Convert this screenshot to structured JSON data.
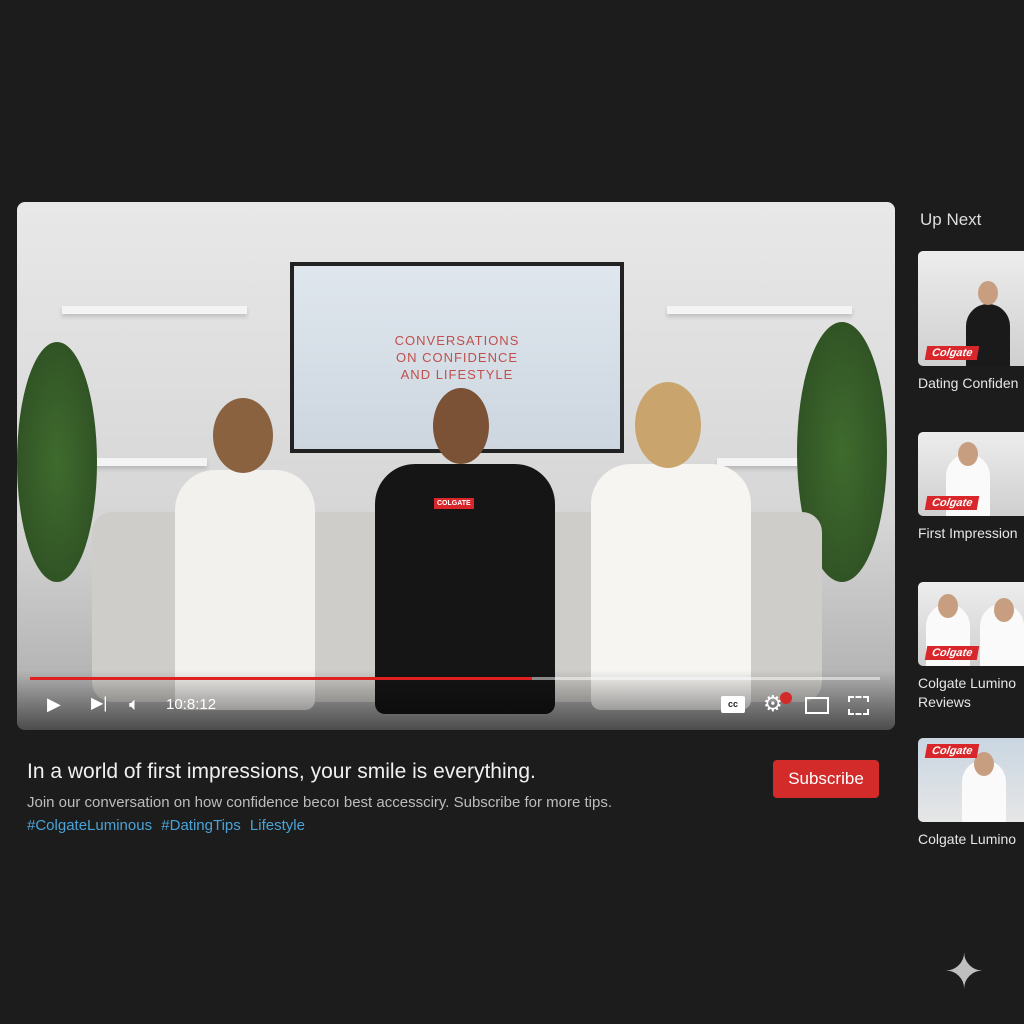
{
  "player": {
    "tv_text": "CONVERSATIONS\nON CONFIDENCE\nAND LIFESTYLE",
    "mic_brand": "COLGATE",
    "progress_percent": 59,
    "time": "10:8:12",
    "icons": [
      "play-icon",
      "next-icon",
      "volume-icon",
      "captions-icon",
      "settings-icon",
      "theater-icon",
      "fullscreen-icon"
    ],
    "settings_badge_color": "#d32a2a"
  },
  "video": {
    "title": "In a world of first impressions, your smile is everything.",
    "description": "Join our conversation on how confidence becoı best accessciry. Subscribe for more tips.",
    "tags": [
      "#ColgateLuminous",
      "#DatingTips",
      "Lifestyle"
    ],
    "subscribe_label": "Subscribe"
  },
  "sidebar": {
    "heading": "Up Next",
    "items": [
      {
        "title": "Dating Confiden",
        "logo": "Colgate"
      },
      {
        "title": "First Impression",
        "logo": "Colgate"
      },
      {
        "title": "Colgate Lumino\nReviews",
        "logo": "Colgate"
      },
      {
        "title": "Colgate Lumino",
        "logo": "Colgate"
      }
    ]
  },
  "colors": {
    "accent": "#d32a2a",
    "tag": "#4aa3d6",
    "background": "#1c1c1d"
  }
}
